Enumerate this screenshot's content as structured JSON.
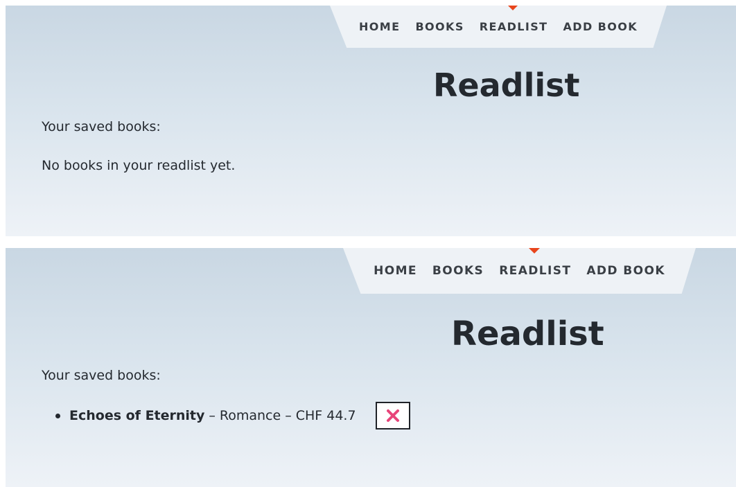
{
  "nav": {
    "items": [
      "HOME",
      "BOOKS",
      "READLIST",
      "ADD BOOK"
    ],
    "active": "READLIST",
    "accent_color": "#e8451c"
  },
  "views": [
    {
      "title": "Readlist",
      "intro": "Your saved books:",
      "empty_message": "No books in your readlist yet."
    },
    {
      "title": "Readlist",
      "intro": "Your saved books:",
      "books": [
        {
          "title": "Echoes of Eternity",
          "separator": "–",
          "genre": "Romance",
          "price": "CHF 44.7",
          "remove_icon": "close-x-icon",
          "remove_icon_color": "#e8457a"
        }
      ]
    }
  ]
}
